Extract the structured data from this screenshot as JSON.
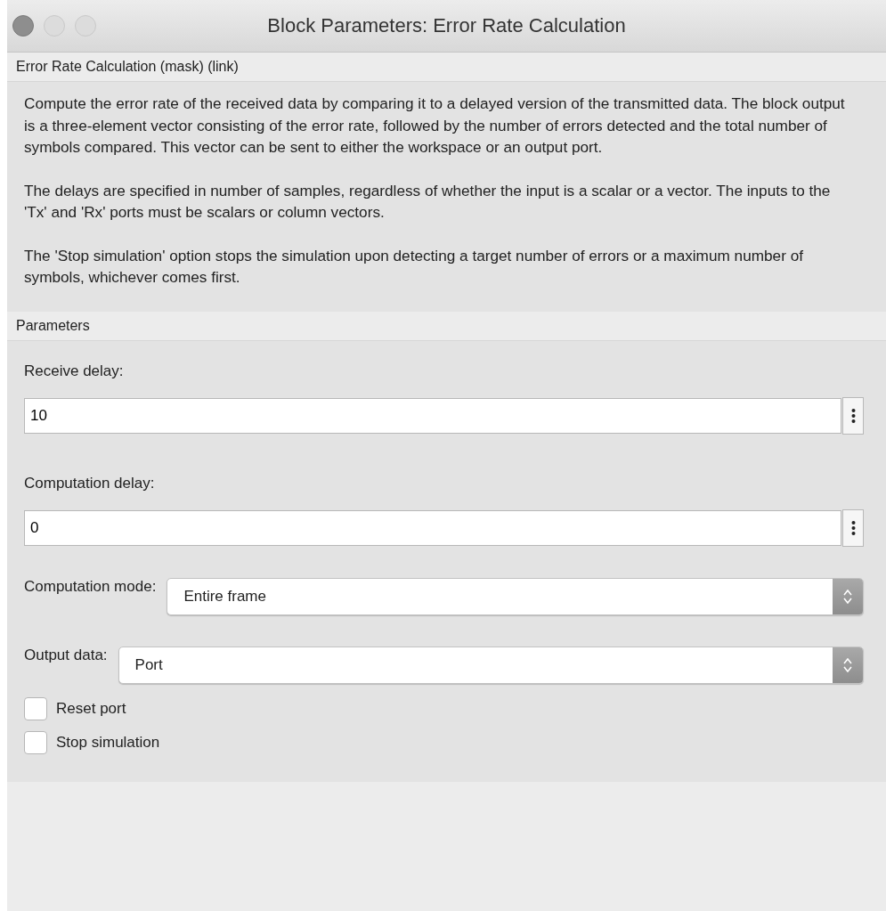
{
  "window": {
    "title": "Block Parameters: Error Rate Calculation"
  },
  "header": {
    "title": "Error Rate Calculation (mask) (link)"
  },
  "description": [
    "Compute the error rate of the received data by comparing it to a delayed version of the transmitted data. The block output is a three-element vector consisting of the error rate, followed by the number of errors detected and the total number of symbols compared. This vector can be sent to either the workspace or an output port.",
    "The delays are specified in number of samples, regardless of whether the input is a scalar or a vector. The inputs to the 'Tx' and 'Rx' ports must be scalars or column vectors.",
    "The 'Stop simulation' option stops the simulation upon detecting a target number of errors or a maximum number of symbols, whichever comes first."
  ],
  "parameters": {
    "title": "Parameters",
    "items": [
      {
        "kind": "edit",
        "label": "Receive delay:",
        "value": "10"
      },
      {
        "kind": "edit",
        "label": "Computation delay:",
        "value": "0"
      },
      {
        "kind": "popup",
        "label": "Computation mode:",
        "value": "Entire frame"
      },
      {
        "kind": "popup",
        "label": "Output data:",
        "value": "Port"
      },
      {
        "kind": "checkbox",
        "label": "Reset port",
        "checked": false
      },
      {
        "kind": "checkbox",
        "label": "Stop simulation",
        "checked": false
      }
    ]
  }
}
